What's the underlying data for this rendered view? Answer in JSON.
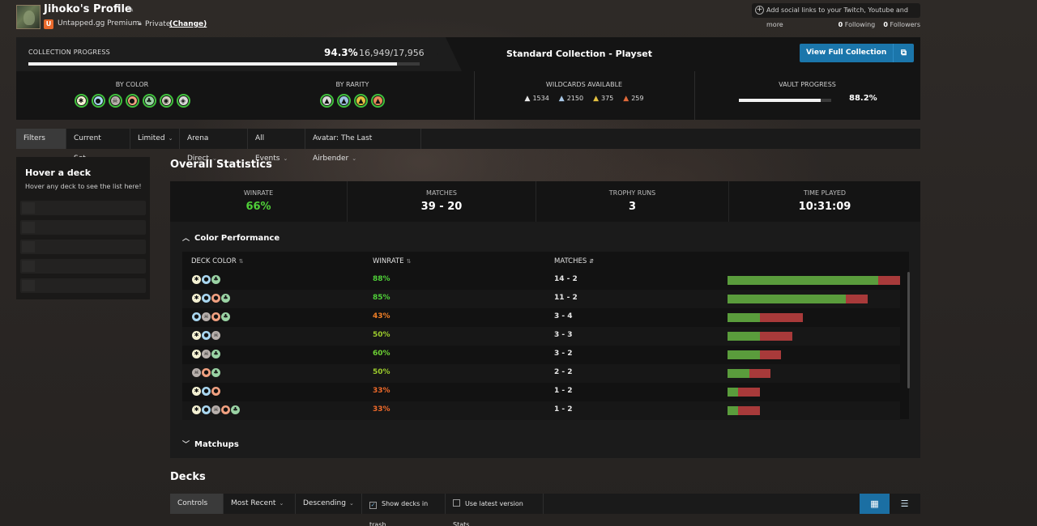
{
  "profile": {
    "name": "Jihoko's Profile",
    "badge_letter": "U",
    "premium": "Untapped.gg Premium",
    "privacy": "Private",
    "change_link": "(Change)",
    "social_link": "Add social links to your Twitch, Youtube and more",
    "following_count": "0",
    "following_label": "Following",
    "followers_count": "0",
    "followers_label": "Followers"
  },
  "collection": {
    "label": "COLLECTION PROGRESS",
    "percent": "94.3%",
    "count": "16,949/17,956",
    "progress": 0.943,
    "title": "Standard Collection - Playset",
    "view_button": "View Full Collection",
    "by_color_label": "BY COLOR",
    "by_rarity_label": "BY RARITY",
    "wildcards_label": "WILDCARDS AVAILABLE",
    "vault_label": "VAULT PROGRESS",
    "vault_percent": "88.2%",
    "vault_progress": 0.882,
    "wildcards": [
      {
        "icon": "common-wildcard-icon",
        "value": "1534",
        "color": "#e8e8e8"
      },
      {
        "icon": "uncommon-wildcard-icon",
        "value": "2150",
        "color": "#a9c8e6"
      },
      {
        "icon": "rare-wildcard-icon",
        "value": "375",
        "color": "#e3c040"
      },
      {
        "icon": "mythic-wildcard-icon",
        "value": "259",
        "color": "#e06a3a"
      }
    ],
    "colors": [
      {
        "name": "white-mana-icon",
        "fill": "#f3f0d2",
        "glyph": "✱"
      },
      {
        "name": "blue-mana-icon",
        "fill": "#a8d6f0",
        "glyph": "●"
      },
      {
        "name": "black-mana-icon",
        "fill": "#b8b0ac",
        "glyph": "☠"
      },
      {
        "name": "red-mana-icon",
        "fill": "#f0a080",
        "glyph": "●"
      },
      {
        "name": "green-mana-icon",
        "fill": "#9ad3a4",
        "glyph": "♣"
      },
      {
        "name": "colorless-mana-icon",
        "fill": "#d6d1c4",
        "glyph": "◉"
      },
      {
        "name": "multicolor-mana-icon",
        "fill": "#d8d8d8",
        "glyph": "◈"
      }
    ],
    "rarities": [
      {
        "name": "common-rarity-icon",
        "fill": "#d8d8d8",
        "glyph": "▲"
      },
      {
        "name": "uncommon-rarity-icon",
        "fill": "#9ec3e0",
        "glyph": "▲"
      },
      {
        "name": "rare-rarity-icon",
        "fill": "#e3c040",
        "glyph": "▲"
      },
      {
        "name": "mythic-rarity-icon",
        "fill": "#e88a5a",
        "glyph": "▲"
      }
    ]
  },
  "filters": {
    "items": [
      "Filters",
      "Current Set",
      "Limited",
      "Arena Direct",
      "All Events",
      "Avatar: The Last Airbender"
    ]
  },
  "hover_panel": {
    "title": "Hover a deck",
    "subtitle": "Hover any deck to see the list here!"
  },
  "overall": {
    "title": "Overall Statistics",
    "stats": [
      {
        "label": "WINRATE",
        "value": "66%"
      },
      {
        "label": "MATCHES",
        "value": "39 - 20"
      },
      {
        "label": "TROPHY RUNS",
        "value": "3"
      },
      {
        "label": "TIME PLAYED",
        "value": "10:31:09"
      }
    ]
  },
  "color_perf": {
    "title": "Color Performance",
    "headers": {
      "deck_color": "DECK COLOR",
      "winrate": "WINRATE",
      "matches": "MATCHES"
    },
    "rows": [
      {
        "colors": [
          "W",
          "U",
          "G"
        ],
        "winrate": "88%",
        "wr_color": "#4fcf38",
        "matches": "14 - 2",
        "wins": 14,
        "losses": 2
      },
      {
        "colors": [
          "W",
          "U",
          "R",
          "G"
        ],
        "winrate": "85%",
        "wr_color": "#4fcf38",
        "matches": "11 - 2",
        "wins": 11,
        "losses": 2
      },
      {
        "colors": [
          "U",
          "B",
          "R",
          "G"
        ],
        "winrate": "43%",
        "wr_color": "#f07f26",
        "matches": "3 - 4",
        "wins": 3,
        "losses": 4
      },
      {
        "colors": [
          "W",
          "U",
          "B"
        ],
        "winrate": "50%",
        "wr_color": "#9ccb2c",
        "matches": "3 - 3",
        "wins": 3,
        "losses": 3
      },
      {
        "colors": [
          "W",
          "B",
          "G"
        ],
        "winrate": "60%",
        "wr_color": "#6cd034",
        "matches": "3 - 2",
        "wins": 3,
        "losses": 2
      },
      {
        "colors": [
          "B",
          "R",
          "G"
        ],
        "winrate": "50%",
        "wr_color": "#9ccb2c",
        "matches": "2 - 2",
        "wins": 2,
        "losses": 2
      },
      {
        "colors": [
          "W",
          "U",
          "R"
        ],
        "winrate": "33%",
        "wr_color": "#f06a2a",
        "matches": "1 - 2",
        "wins": 1,
        "losses": 2
      },
      {
        "colors": [
          "W",
          "U",
          "B",
          "R",
          "G"
        ],
        "winrate": "33%",
        "wr_color": "#f06a2a",
        "matches": "1 - 2",
        "wins": 1,
        "losses": 2
      }
    ],
    "matchups_title": "Matchups"
  },
  "decks": {
    "title": "Decks",
    "controls": {
      "label": "Controls",
      "sort": "Most Recent",
      "order": "Descending",
      "show_trash": "Show decks in trash",
      "latest_version": "Use latest version Stats"
    }
  }
}
